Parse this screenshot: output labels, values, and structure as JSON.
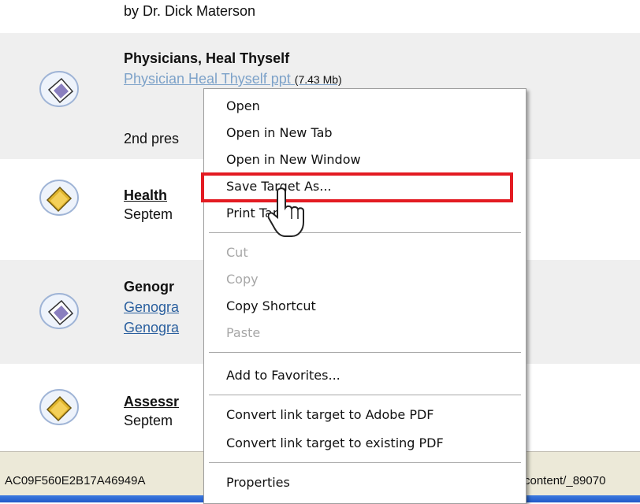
{
  "page": {
    "rows": [
      {
        "lines": [
          "by Dr. Dick Materson"
        ]
      },
      {
        "title": "Physicians, Heal Thyself",
        "link": "Physician  Heal Thyself ppt",
        "size": "(7.43 Mb)",
        "extra": "2nd pres"
      },
      {
        "title": "Health",
        "sub": "Septem"
      },
      {
        "title": "Genogr",
        "link1": "Genogra",
        "link2": "Genogra"
      },
      {
        "title": "Assessr",
        "sub": "Septem"
      }
    ]
  },
  "status": {
    "left": "AC09F560E2B17A46949A",
    "right": "content/_89070"
  },
  "context_menu": {
    "items": [
      {
        "label": "Open",
        "enabled": true
      },
      {
        "label": "Open in New Tab",
        "enabled": true
      },
      {
        "label": "Open in New Window",
        "enabled": true
      },
      {
        "label": "Save Target As...",
        "enabled": true,
        "highlighted": true
      },
      {
        "label": "Print Targ",
        "enabled": true
      },
      {
        "label": "Cut",
        "enabled": false
      },
      {
        "label": "Copy",
        "enabled": false
      },
      {
        "label": "Copy Shortcut",
        "enabled": true
      },
      {
        "label": "Paste",
        "enabled": false
      },
      {
        "label": "Add to Favorites...",
        "enabled": true
      },
      {
        "label": "Convert link target to Adobe PDF",
        "enabled": true
      },
      {
        "label": "Convert link target to existing PDF",
        "enabled": true
      },
      {
        "label": "Properties",
        "enabled": true
      }
    ]
  },
  "colors": {
    "highlight_box": "#e31b22",
    "row_gray": "#efefef",
    "link": "#2a5f9e"
  },
  "icons": [
    "presentation-file-icon",
    "folder-icon",
    "hand-pointer-cursor-icon"
  ]
}
